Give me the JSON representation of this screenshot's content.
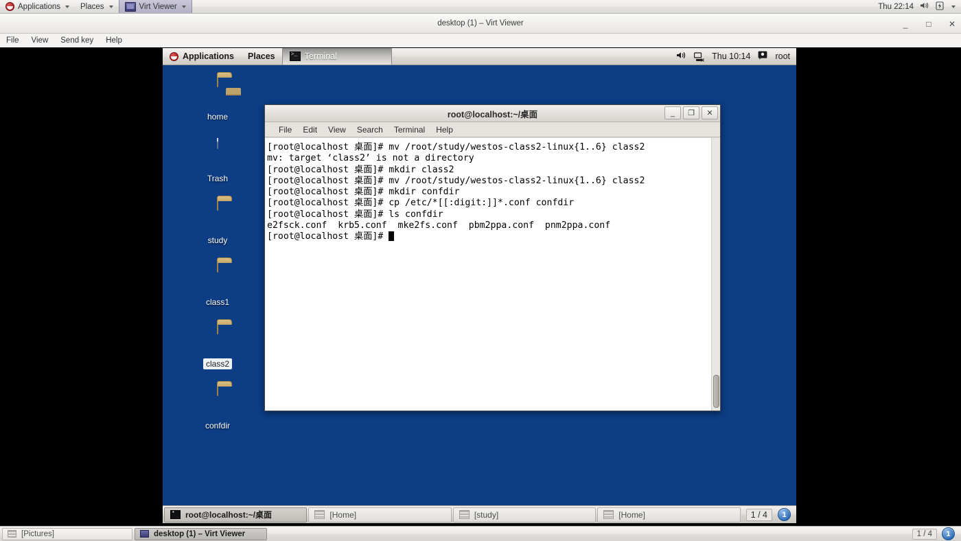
{
  "host_panel": {
    "applications_label": "Applications",
    "places_label": "Places",
    "active_task_label": "Virt Viewer",
    "logo_icon": "fedora-logo-icon",
    "caret_icon": "caret-down-icon",
    "clock": "Thu 22:14",
    "volume_icon": "speaker-icon",
    "battery_icon": "battery-icon",
    "tray_caret_icon": "caret-down-icon"
  },
  "virt_viewer": {
    "window_title": "desktop (1) – Virt Viewer",
    "minimize_label": "_",
    "maximize_label": "□",
    "close_label": "✕",
    "menu": [
      "File",
      "View",
      "Send key",
      "Help"
    ]
  },
  "guest_panel": {
    "applications_label": "Applications",
    "places_label": "Places",
    "window_button_label": "Terminal",
    "window_icon": "terminal-icon",
    "logo_icon": "fedora-logo-icon",
    "volume_icon": "speaker-icon",
    "network_icon": "network-disconnected-icon",
    "clock": "Thu 10:14",
    "user_icon": "user-icon",
    "user_label": "root"
  },
  "desktop_icons": [
    {
      "label": "home",
      "type": "folder-home",
      "selected": false
    },
    {
      "label": "Trash",
      "type": "trash",
      "selected": false
    },
    {
      "label": "study",
      "type": "folder",
      "selected": false
    },
    {
      "label": "class1",
      "type": "folder",
      "selected": false
    },
    {
      "label": "class2",
      "type": "folder",
      "selected": true
    },
    {
      "label": "confdir",
      "type": "folder",
      "selected": false
    }
  ],
  "terminal": {
    "title": "root@localhost:~/桌面",
    "minimize_label": "_",
    "maximize_label": "❐",
    "close_label": "✕",
    "menu": [
      "File",
      "Edit",
      "View",
      "Search",
      "Terminal",
      "Help"
    ],
    "prompt": "[root@localhost 桌面]# ",
    "lines": [
      {
        "kind": "command",
        "prompt": "[root@localhost 桌面]# ",
        "text": "mv /root/study/westos-class2-linux{1..6} class2"
      },
      {
        "kind": "output",
        "prompt": "",
        "text": "mv: target ‘class2’ is not a directory"
      },
      {
        "kind": "command",
        "prompt": "[root@localhost 桌面]# ",
        "text": "mkdir class2"
      },
      {
        "kind": "command",
        "prompt": "[root@localhost 桌面]# ",
        "text": "mv /root/study/westos-class2-linux{1..6} class2"
      },
      {
        "kind": "command",
        "prompt": "[root@localhost 桌面]# ",
        "text": "mkdir confdir"
      },
      {
        "kind": "command",
        "prompt": "[root@localhost 桌面]# ",
        "text": "cp /etc/*[[:digit:]]*.conf confdir"
      },
      {
        "kind": "command",
        "prompt": "[root@localhost 桌面]# ",
        "text": "ls confdir"
      },
      {
        "kind": "output",
        "prompt": "",
        "text": "e2fsck.conf  krb5.conf  mke2fs.conf  pbm2ppa.conf  pnm2ppa.conf"
      },
      {
        "kind": "cursor",
        "prompt": "[root@localhost 桌面]# ",
        "text": ""
      }
    ]
  },
  "guest_taskbar": {
    "tasks": [
      {
        "label": "root@localhost:~/桌面",
        "icon": "terminal-icon",
        "active": true
      },
      {
        "label": "[Home]",
        "icon": "window-icon",
        "active": false
      },
      {
        "label": "[study]",
        "icon": "window-icon",
        "active": false
      },
      {
        "label": "[Home]",
        "icon": "window-icon",
        "active": false
      }
    ],
    "pager": "1 / 4",
    "workspace_badge": "1"
  },
  "host_taskbar": {
    "tasks": [
      {
        "label": "[Pictures]",
        "icon": "window-icon",
        "active": false
      },
      {
        "label": "desktop (1) – Virt Viewer",
        "icon": "virt-viewer-icon",
        "active": true
      }
    ],
    "pager": "1 / 4",
    "workspace_badge": "1"
  },
  "colors": {
    "desktop_background": "#0c3d85",
    "panel_background": "#e4e1dd",
    "terminal_background": "#ffffff",
    "terminal_text": "#000000",
    "viewport_background": "#000000",
    "accent_badge": "#2b6cb5"
  }
}
